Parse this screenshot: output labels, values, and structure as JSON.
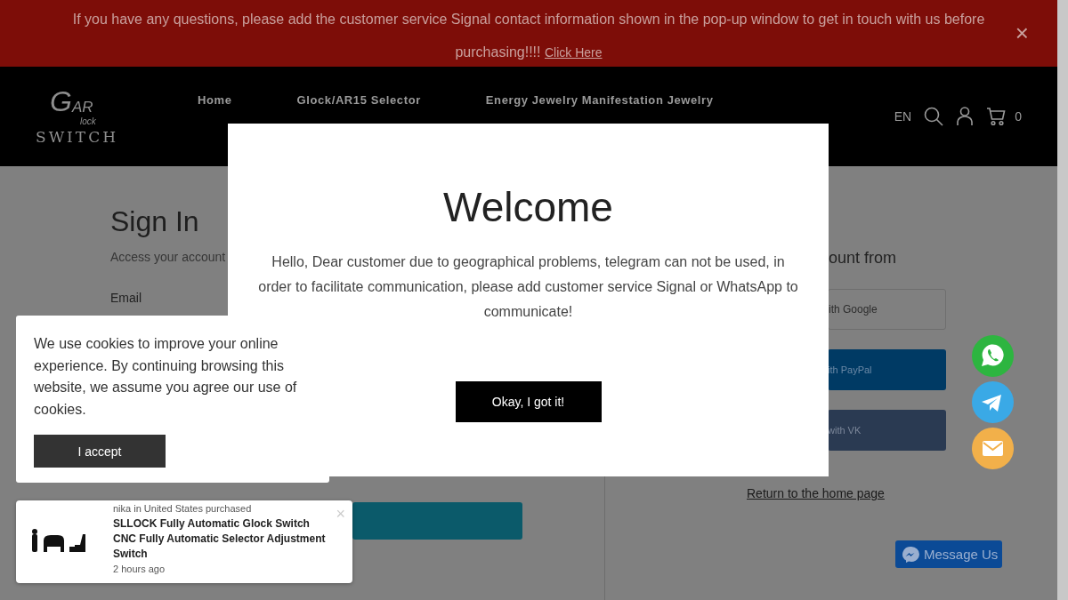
{
  "banner": {
    "text": "If you have any questions, please add the customer service Signal contact information shown in the pop-up window to get in touch with us before purchasing!!!!",
    "link": "Click Here",
    "close": "×"
  },
  "header": {
    "logo": {
      "initial": "G",
      "rest": "AR",
      "middle": "lock",
      "bottom": "SWITCH"
    },
    "nav": [
      "Home",
      "Glock/AR15 Selector",
      "Energy Jewelry Manifestation Jewelry"
    ],
    "language": "EN",
    "cart_count": "0"
  },
  "sign_in": {
    "title": "Sign In",
    "subtitle": "Access your account",
    "email_label": "Email"
  },
  "social": {
    "heading": "ount from",
    "buttons": [
      {
        "kind": "google",
        "label": "ith Google"
      },
      {
        "kind": "paypal",
        "label": "ith PayPal"
      },
      {
        "kind": "vk",
        "label": "with VK"
      }
    ],
    "home_link": "Return to the home page"
  },
  "modal": {
    "title": "Welcome",
    "message": "Hello, Dear customer due to geographical problems, telegram can not be used, in order to facilitate communication, please add customer service Signal or WhatsApp to communicate!",
    "button": "Okay, I got it!"
  },
  "cookie": {
    "text": "We use cookies to improve your online experience. By continuing browsing this website, we assume you agree our use of cookies.",
    "button": "I accept"
  },
  "toast": {
    "buyer": "nika in United States purchased",
    "product": "SLLOCK Fully Automatic Glock Switch CNC Fully Automatic Selector Adjustment Switch",
    "time": "2 hours ago",
    "close": "×"
  },
  "contact_buttons": [
    {
      "kind": "whatsapp"
    },
    {
      "kind": "telegram"
    },
    {
      "kind": "email"
    }
  ],
  "messenger": {
    "label": "Message Us"
  }
}
